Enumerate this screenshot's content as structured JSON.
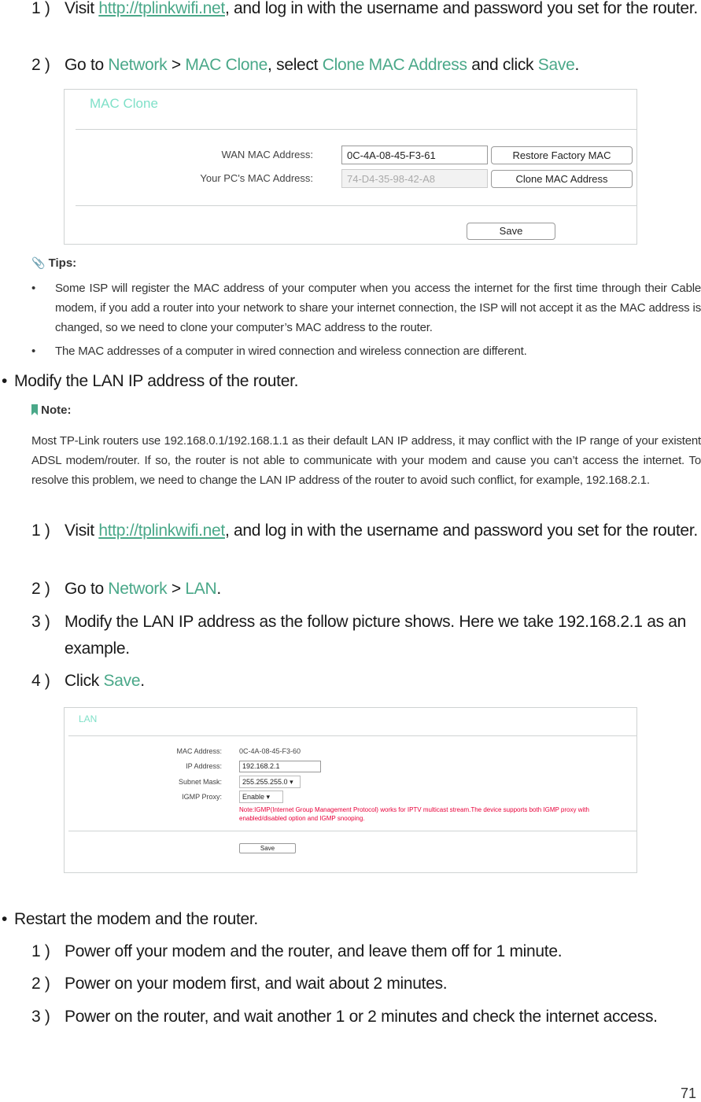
{
  "section1": {
    "step1": {
      "num": "1 )",
      "pre": "Visit ",
      "link": "http://tplinkwifi.net",
      "post": ", and log in with the username and password you set for the router."
    },
    "step2": {
      "num": "2 )",
      "pre": "Go to ",
      "nav1": "Network",
      "sep": " > ",
      "nav2": "MAC Clone",
      "mid": ", select ",
      "action": "Clone MAC Address",
      "mid2": " and click ",
      "save": "Save",
      "end": "."
    }
  },
  "mac_clone_panel": {
    "title": "MAC Clone",
    "wan_label": "WAN MAC Address:",
    "wan_value": "0C-4A-08-45-F3-61",
    "pc_label": "Your PC's MAC Address:",
    "pc_value": "74-D4-35-98-42-A8",
    "restore_button": "Restore Factory MAC",
    "clone_button": "Clone MAC Address",
    "save_button": "Save"
  },
  "tips": {
    "icon": "paperclip-icon",
    "header": "Tips:",
    "items": [
      "Some ISP will register the MAC address of your computer when you access the internet for the first time through their Cable modem, if you add a router into your network to share your internet connection, the ISP will not accept it as the MAC address is changed, so we need to clone your computer’s MAC address to the router.",
      "The MAC addresses of a computer in wired connection and wireless connection are different."
    ]
  },
  "bullet_lan": "Modify the LAN IP address of the router.",
  "note": {
    "icon": "bookmark-icon",
    "header": "Note:",
    "text": "Most TP-Link routers use 192.168.0.1/192.168.1.1 as their default LAN IP address, it may conflict with the IP range of your existent ADSL modem/router. If so, the router is not able to communicate with your modem and cause you can’t access the internet. To resolve this problem, we need to change the LAN IP address of the router to avoid such conflict, for example, 192.168.2.1."
  },
  "section2": {
    "step1": {
      "num": "1 )",
      "pre": "Visit ",
      "link": "http://tplinkwifi.net",
      "post": ", and log in with the username and password you set for the router."
    },
    "step2": {
      "num": "2 )",
      "pre": "Go to ",
      "nav1": "Network",
      "sep": " > ",
      "nav2": "LAN",
      "end": "."
    },
    "step3": {
      "num": "3 )",
      "text": "Modify the LAN IP address as the follow picture shows. Here we take 192.168.2.1 as an example."
    },
    "step4": {
      "num": "4 )",
      "pre": "Click ",
      "save": "Save",
      "end": "."
    }
  },
  "lan_panel": {
    "title": "LAN",
    "mac_label": "MAC Address:",
    "mac_value": "0C-4A-08-45-F3-60",
    "ip_label": "IP Address:",
    "ip_value": "192.168.2.1",
    "mask_label": "Subnet Mask:",
    "mask_value": "255.255.255.0",
    "igmp_label": "IGMP Proxy:",
    "igmp_value": "Enable",
    "note": "Note:IGMP(Internet Group Management Protocol) works for IPTV multicast stream.The device supports both IGMP proxy with enabled/disabled option and IGMP snooping.",
    "save_button": "Save"
  },
  "bullet_restart": "Restart the modem and the router.",
  "section3": {
    "step1": {
      "num": "1 )",
      "text": "Power off your modem and the router, and leave them off for 1 minute."
    },
    "step2": {
      "num": "2 )",
      "text": "Power on your modem first, and wait about 2 minutes."
    },
    "step3": {
      "num": "3 )",
      "text": "Power on the router, and wait another 1 or 2 minutes and check the internet access."
    }
  },
  "page_number": "71",
  "colors": {
    "accent": "#4aa889",
    "panel_title": "#7fe0c8",
    "warning": "#e8003a"
  }
}
